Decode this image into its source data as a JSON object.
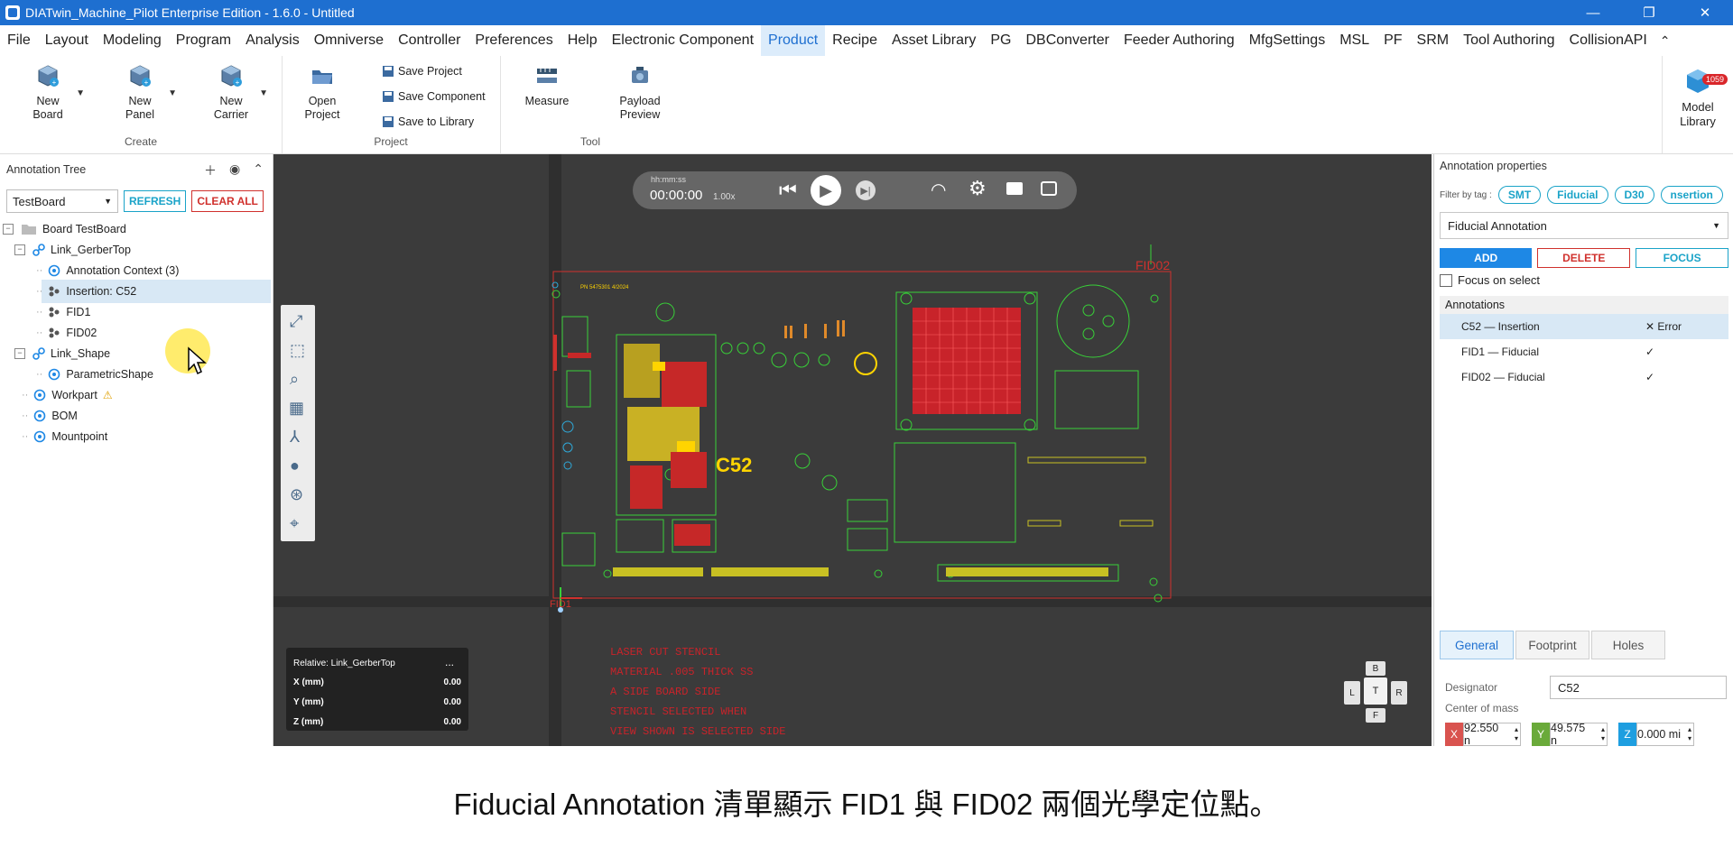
{
  "window": {
    "title": "DIATwin_Machine_Pilot Enterprise Edition - 1.6.0 - Untitled",
    "btn_min": "—",
    "btn_restore": "❐",
    "btn_close": "✕"
  },
  "menu": [
    "File",
    "Layout",
    "Modeling",
    "Program",
    "Analysis",
    "Omniverse",
    "Controller",
    "Preferences",
    "Help",
    "Electronic Component",
    "Product",
    "Recipe",
    "Asset Library",
    "PG",
    "DBConverter",
    "Feeder Authoring",
    "MfgSettings",
    "MSL",
    "PF",
    "SRM",
    "Tool Authoring",
    "CollisionAPI"
  ],
  "menu_active": "Product",
  "ribbon": {
    "create": {
      "label": "Create",
      "new_board": [
        "New",
        "Board"
      ],
      "new_panel": [
        "New",
        "Panel"
      ],
      "new_carrier": [
        "New",
        "Carrier"
      ]
    },
    "project": {
      "label": "Project",
      "open_project": [
        "Open",
        "Project"
      ],
      "save_project": "Save Project",
      "save_component": "Save Component",
      "save_library": "Save to Library"
    },
    "tool": {
      "label": "Tool",
      "measure": "Measure",
      "payload": [
        "Payload",
        "Preview"
      ]
    },
    "model_library": [
      "Model",
      "Library"
    ],
    "model_library_badge": "1059"
  },
  "left": {
    "header": "Annotation Tree",
    "board_select": "TestBoard",
    "refresh": "REFRESH",
    "clear_all": "CLEAR ALL",
    "tree": [
      {
        "label": "Board  TestBoard",
        "icon": "folder-icon"
      },
      {
        "label": "Link_GerberTop",
        "icon": "link-icon"
      },
      {
        "label": "Annotation Context (3)",
        "icon": "context-icon"
      },
      {
        "label": "Insertion: C52",
        "icon": "component-icon"
      },
      {
        "label": "FID1",
        "icon": "component-icon"
      },
      {
        "label": "FID02",
        "icon": "component-icon"
      },
      {
        "label": "Link_Shape",
        "icon": "link-icon"
      },
      {
        "label": "ParametricShape",
        "icon": "context-icon"
      },
      {
        "label": "Workpart",
        "icon": "context-icon"
      },
      {
        "label": "BOM",
        "icon": "context-icon"
      },
      {
        "label": "Mountpoint",
        "icon": "context-icon"
      }
    ],
    "warning_glyph": "⚠"
  },
  "viewport": {
    "timeline": {
      "label": "hh:mm:ss",
      "time": "00:00:00",
      "speed": "1.00x"
    },
    "designator_label": "C52",
    "fid02_label": "FID02",
    "fid1_label": "FID1",
    "board_text": "PN 5475301  4/2024",
    "relative": {
      "title": "Relative: Link_GerberTop",
      "menu": "...",
      "x_label": "X (mm)",
      "x": "0.00",
      "y_label": "Y (mm)",
      "y": "0.00",
      "z_label": "Z (mm)",
      "z": "0.00"
    },
    "notes": [
      "LASER CUT STENCIL",
      "MATERIAL .005 THICK SS",
      "A SIDE BOARD SIDE",
      "STENCIL SELECTED WHEN",
      "VIEW SHOWN IS SELECTED SIDE"
    ],
    "viewcube": {
      "b": "B",
      "l": "L",
      "t": "T",
      "r": "R",
      "f": "F"
    }
  },
  "right": {
    "header": "Annotation properties",
    "filter_label": "Filter by tag :",
    "tags": [
      "SMT",
      "Fiducial",
      "D30",
      "nsertion"
    ],
    "type_select": "Fiducial Annotation",
    "add": "ADD",
    "delete": "DELETE",
    "focus": "FOCUS",
    "focus_on_select": "Focus on select",
    "annotations_header": "Annotations",
    "annotations": [
      {
        "name": "C52 — Insertion",
        "status": "✕ Error"
      },
      {
        "name": "FID1 — Fiducial",
        "status": "✓"
      },
      {
        "name": "FID02 — Fiducial",
        "status": "✓"
      }
    ],
    "tabs": [
      "General",
      "Footprint",
      "Holes"
    ],
    "designator_label": "Designator",
    "designator": "C52",
    "com_label": "Center of mass",
    "x": "92.550 n",
    "y": "49.575 n",
    "z": "0.000 mi",
    "colors": {
      "x": "#d9534f",
      "y": "#6aaa3a",
      "z": "#1e9ee0"
    }
  },
  "caption": "Fiducial Annotation 清單顯示 FID1 與 FID02 兩個光學定位點。"
}
